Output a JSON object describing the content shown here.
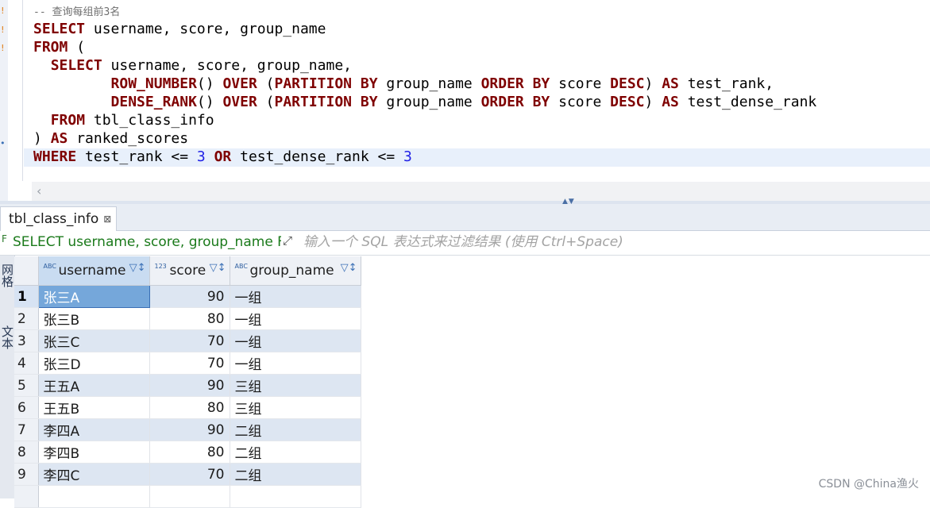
{
  "editor": {
    "comment": "-- 查询每组前3名",
    "lines": [
      {
        "parts": [
          [
            "kw",
            "SELECT"
          ],
          [
            "t",
            " username, score, group_name"
          ]
        ]
      },
      {
        "parts": [
          [
            "kw",
            "FROM"
          ],
          [
            "t",
            " ("
          ]
        ]
      },
      {
        "parts": [
          [
            "t",
            "  "
          ],
          [
            "kw",
            "SELECT"
          ],
          [
            "t",
            " username, score, group_name,"
          ]
        ]
      },
      {
        "parts": [
          [
            "t",
            "         "
          ],
          [
            "kw",
            "ROW_NUMBER"
          ],
          [
            "t",
            "() "
          ],
          [
            "kw",
            "OVER"
          ],
          [
            "t",
            " ("
          ],
          [
            "kw",
            "PARTITION BY"
          ],
          [
            "t",
            " group_name "
          ],
          [
            "kw",
            "ORDER BY"
          ],
          [
            "t",
            " score "
          ],
          [
            "kw",
            "DESC"
          ],
          [
            "t",
            ") "
          ],
          [
            "kw",
            "AS"
          ],
          [
            "t",
            " test_rank,"
          ]
        ]
      },
      {
        "parts": [
          [
            "t",
            "         "
          ],
          [
            "kw",
            "DENSE_RANK"
          ],
          [
            "t",
            "() "
          ],
          [
            "kw",
            "OVER"
          ],
          [
            "t",
            " ("
          ],
          [
            "kw",
            "PARTITION BY"
          ],
          [
            "t",
            " group_name "
          ],
          [
            "kw",
            "ORDER BY"
          ],
          [
            "t",
            " score "
          ],
          [
            "kw",
            "DESC"
          ],
          [
            "t",
            ") "
          ],
          [
            "kw",
            "AS"
          ],
          [
            "t",
            " test_dense_rank"
          ]
        ]
      },
      {
        "parts": [
          [
            "t",
            "  "
          ],
          [
            "kw",
            "FROM"
          ],
          [
            "t",
            " tbl_class_info"
          ]
        ]
      },
      {
        "parts": [
          [
            "t",
            ") "
          ],
          [
            "kw",
            "AS"
          ],
          [
            "t",
            " ranked_scores"
          ]
        ]
      },
      {
        "parts": [
          [
            "kw",
            "WHERE"
          ],
          [
            "t",
            " test_rank <= "
          ],
          [
            "num",
            "3"
          ],
          [
            "t",
            " "
          ],
          [
            "kw",
            "OR"
          ],
          [
            "t",
            " test_dense_rank <= "
          ],
          [
            "num",
            "3"
          ]
        ]
      }
    ],
    "current_line_index": 7
  },
  "results_tab": {
    "label": "tbl_class_info",
    "close_glyph": "⊠"
  },
  "filter": {
    "query_preview": "SELECT username, score, group_name F",
    "placeholder": "输入一个 SQL 表达式来过滤结果 (使用 Ctrl+Space)"
  },
  "side_panel": {
    "tab1": "网格",
    "tab2": "文本"
  },
  "grid": {
    "columns": [
      {
        "key": "username",
        "label": "username",
        "type_glyph": "ABC",
        "ctrl": "▽↕"
      },
      {
        "key": "score",
        "label": "score",
        "type_glyph": "123",
        "ctrl": "▽↕"
      },
      {
        "key": "group_name",
        "label": "group_name",
        "type_glyph": "ABC",
        "ctrl": "▽↕"
      }
    ],
    "rows": [
      {
        "n": "1",
        "username": "张三A",
        "score": "90",
        "group_name": "一组"
      },
      {
        "n": "2",
        "username": "张三B",
        "score": "80",
        "group_name": "一组"
      },
      {
        "n": "3",
        "username": "张三C",
        "score": "70",
        "group_name": "一组"
      },
      {
        "n": "4",
        "username": "张三D",
        "score": "70",
        "group_name": "一组"
      },
      {
        "n": "5",
        "username": "王五A",
        "score": "90",
        "group_name": "三组"
      },
      {
        "n": "6",
        "username": "王五B",
        "score": "80",
        "group_name": "三组"
      },
      {
        "n": "7",
        "username": "李四A",
        "score": "90",
        "group_name": "二组"
      },
      {
        "n": "8",
        "username": "李四B",
        "score": "80",
        "group_name": "二组"
      },
      {
        "n": "9",
        "username": "李四C",
        "score": "70",
        "group_name": "二组"
      }
    ],
    "selected_row": 0
  },
  "watermark": "CSDN @China渔火",
  "colors": {
    "keyword": "#7f0000",
    "number": "#1f1fe6",
    "filter_text": "#1b7a1b",
    "selection": "#75a7da"
  }
}
